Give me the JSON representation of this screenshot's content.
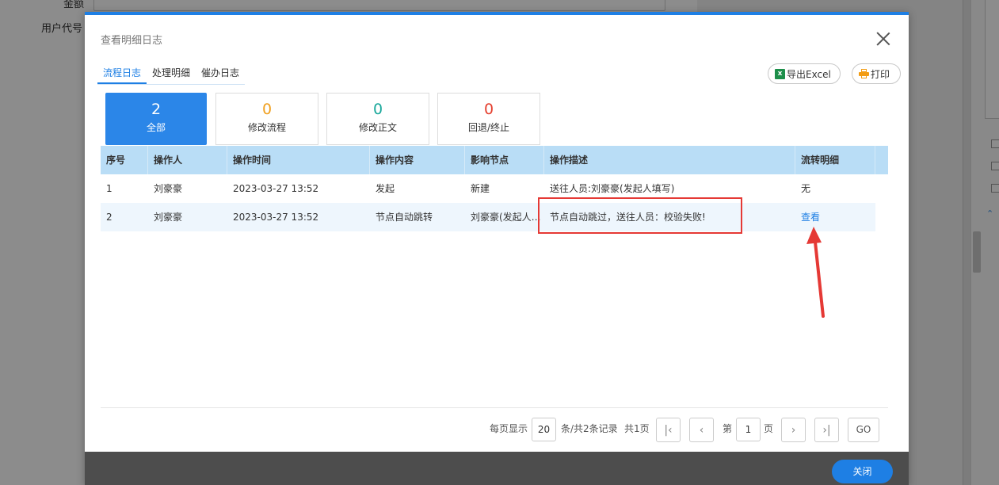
{
  "background": {
    "label_top": "金额",
    "label_user_code": "用户代号"
  },
  "dialog": {
    "title": "查看明细日志",
    "close_label": "关闭"
  },
  "tabs": [
    {
      "label": "流程日志",
      "active": true
    },
    {
      "label": "处理明细",
      "active": false
    },
    {
      "label": "催办日志",
      "active": false
    }
  ],
  "toolbar": {
    "export_icon": "excel-icon",
    "export_label": "导出Excel",
    "print_icon": "printer-icon",
    "print_label": "打印"
  },
  "stats": [
    {
      "count": "2",
      "label": "全部",
      "color": "#ffffff",
      "active": true
    },
    {
      "count": "0",
      "label": "修改流程",
      "color": "#f0a020",
      "active": false
    },
    {
      "count": "0",
      "label": "修改正文",
      "color": "#1aa89b",
      "active": false
    },
    {
      "count": "0",
      "label": "回退/终止",
      "color": "#e5402f",
      "active": false
    }
  ],
  "table": {
    "columns": [
      "序号",
      "操作人",
      "操作时间",
      "操作内容",
      "影响节点",
      "操作描述",
      "流转明细"
    ],
    "rows": [
      [
        "1",
        "刘豪豪",
        "2023-03-27 13:52",
        "发起",
        "新建",
        "送往人员:刘豪豪(发起人填写)",
        "无"
      ],
      [
        "2",
        "刘豪豪",
        "2023-03-27 13:52",
        "节点自动跳转",
        "刘豪豪(发起人…",
        "节点自动跳过，送往人员：校验失败!",
        "查看"
      ]
    ]
  },
  "pagination": {
    "per_page_prefix": "每页显示",
    "per_page": "20",
    "per_page_suffix": "条/共2条记录",
    "total_pages": "共1页",
    "page_prefix": "第",
    "current_page": "1",
    "page_suffix": "页",
    "first_icon": "first-page-icon",
    "prev_icon": "prev-page-icon",
    "next_icon": "next-page-icon",
    "last_icon": "last-page-icon",
    "go_label": "GO"
  },
  "annotation": {
    "highlight_color": "#e53935"
  }
}
